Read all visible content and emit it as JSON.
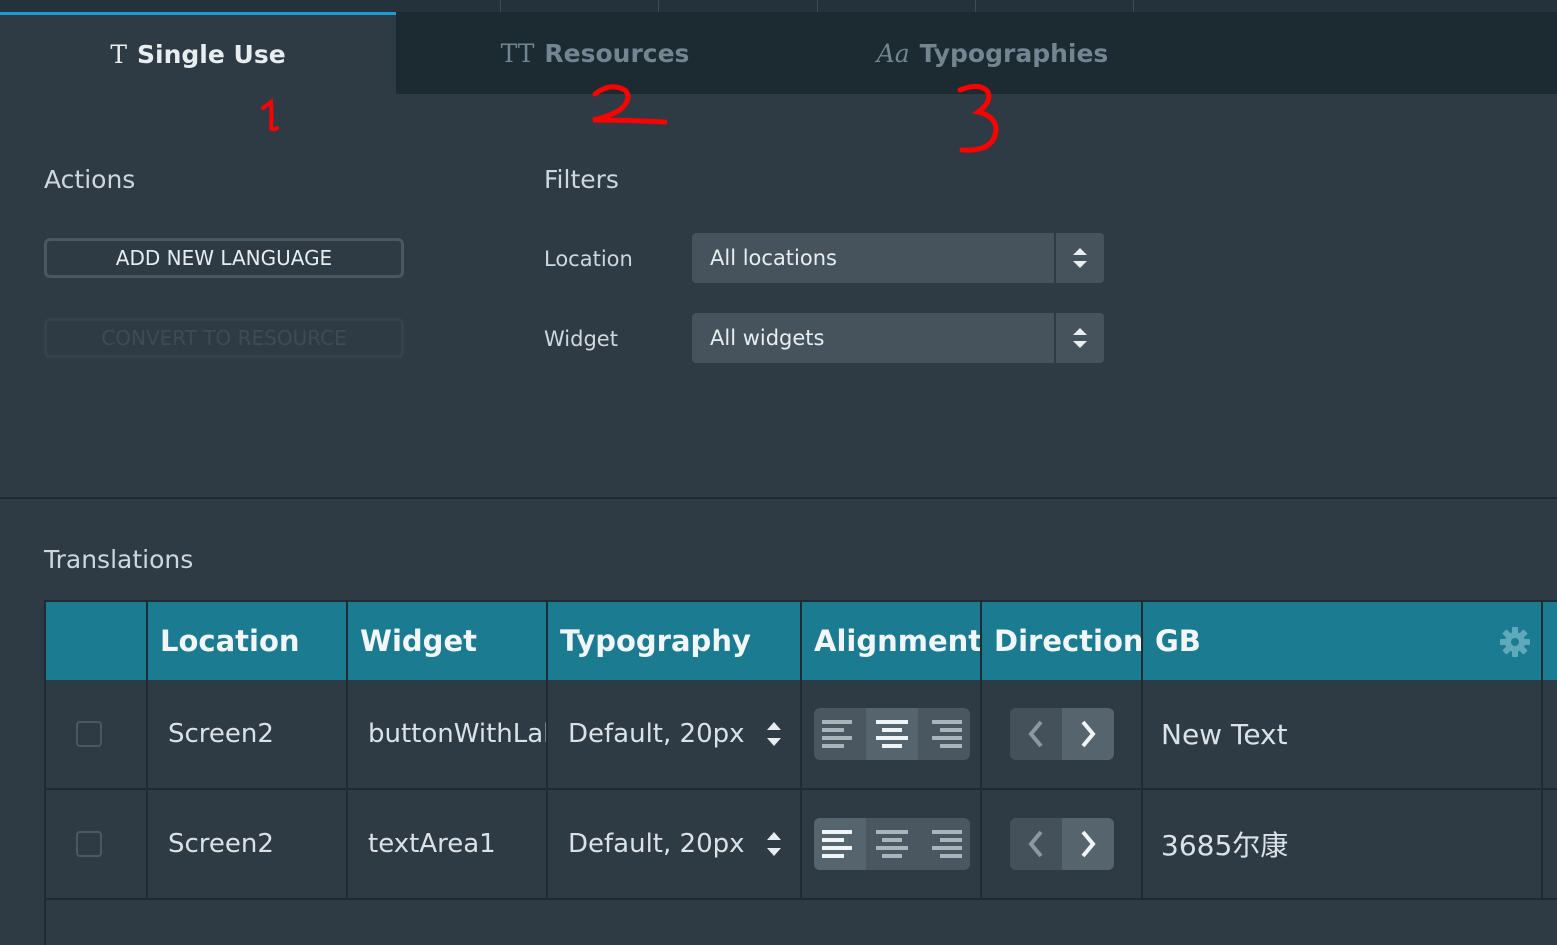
{
  "tabs": [
    {
      "icon": "T",
      "label": "Single Use"
    },
    {
      "icon": "TT",
      "label": "Resources"
    },
    {
      "icon": "Aa",
      "label": "Typographies"
    }
  ],
  "annotations": [
    "1",
    "2",
    "3"
  ],
  "actions": {
    "title": "Actions",
    "add_language": "ADD NEW LANGUAGE",
    "convert_to_resource": "CONVERT TO RESOURCE"
  },
  "filters": {
    "title": "Filters",
    "location_label": "Location",
    "location_value": "All locations",
    "widget_label": "Widget",
    "widget_value": "All widgets"
  },
  "translations": {
    "title": "Translations",
    "columns": [
      "Location",
      "Widget",
      "Typography",
      "Alignment",
      "Direction",
      "GB"
    ],
    "rows": [
      {
        "location": "Screen2",
        "widget": "buttonWithLabel",
        "typography": "Default, 20px",
        "alignment": "center",
        "direction": "ltr",
        "gb": "New Text"
      },
      {
        "location": "Screen2",
        "widget": "textArea1",
        "typography": "Default, 20px",
        "alignment": "left",
        "direction": "ltr",
        "gb": "3685尔康"
      }
    ]
  },
  "colors": {
    "accent": "#1d9cd3",
    "header": "#1b7b91",
    "annotation": "#ff0000"
  }
}
